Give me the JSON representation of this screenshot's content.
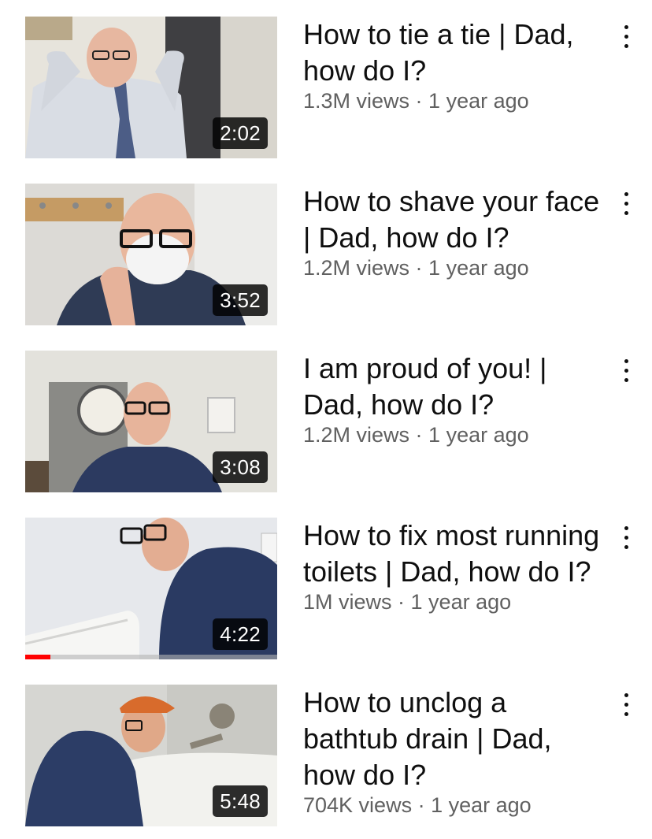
{
  "videos": [
    {
      "title": "How to tie a tie | Dad, how do I?",
      "views": "1.3M views",
      "age": "1 year ago",
      "duration": "2:02",
      "watched_fraction": 0
    },
    {
      "title": "How to shave your face | Dad, how do I?",
      "views": "1.2M views",
      "age": "1 year ago",
      "duration": "3:52",
      "watched_fraction": 0
    },
    {
      "title": "I am proud of you! | Dad, how do I?",
      "views": "1.2M views",
      "age": "1 year ago",
      "duration": "3:08",
      "watched_fraction": 0
    },
    {
      "title": "How to fix most running toilets | Dad, how do I?",
      "views": "1M views",
      "age": "1 year ago",
      "duration": "4:22",
      "watched_fraction": 0.1
    },
    {
      "title": "How to unclog a bathtub drain | Dad, how do I?",
      "views": "704K views",
      "age": "1 year ago",
      "duration": "5:48",
      "watched_fraction": 0
    }
  ],
  "separator": " · ",
  "icons": {
    "more": "more-vert-icon"
  },
  "colors": {
    "progress": "#ff0000",
    "meta_text": "#606060",
    "title_text": "#0f0f0f"
  }
}
